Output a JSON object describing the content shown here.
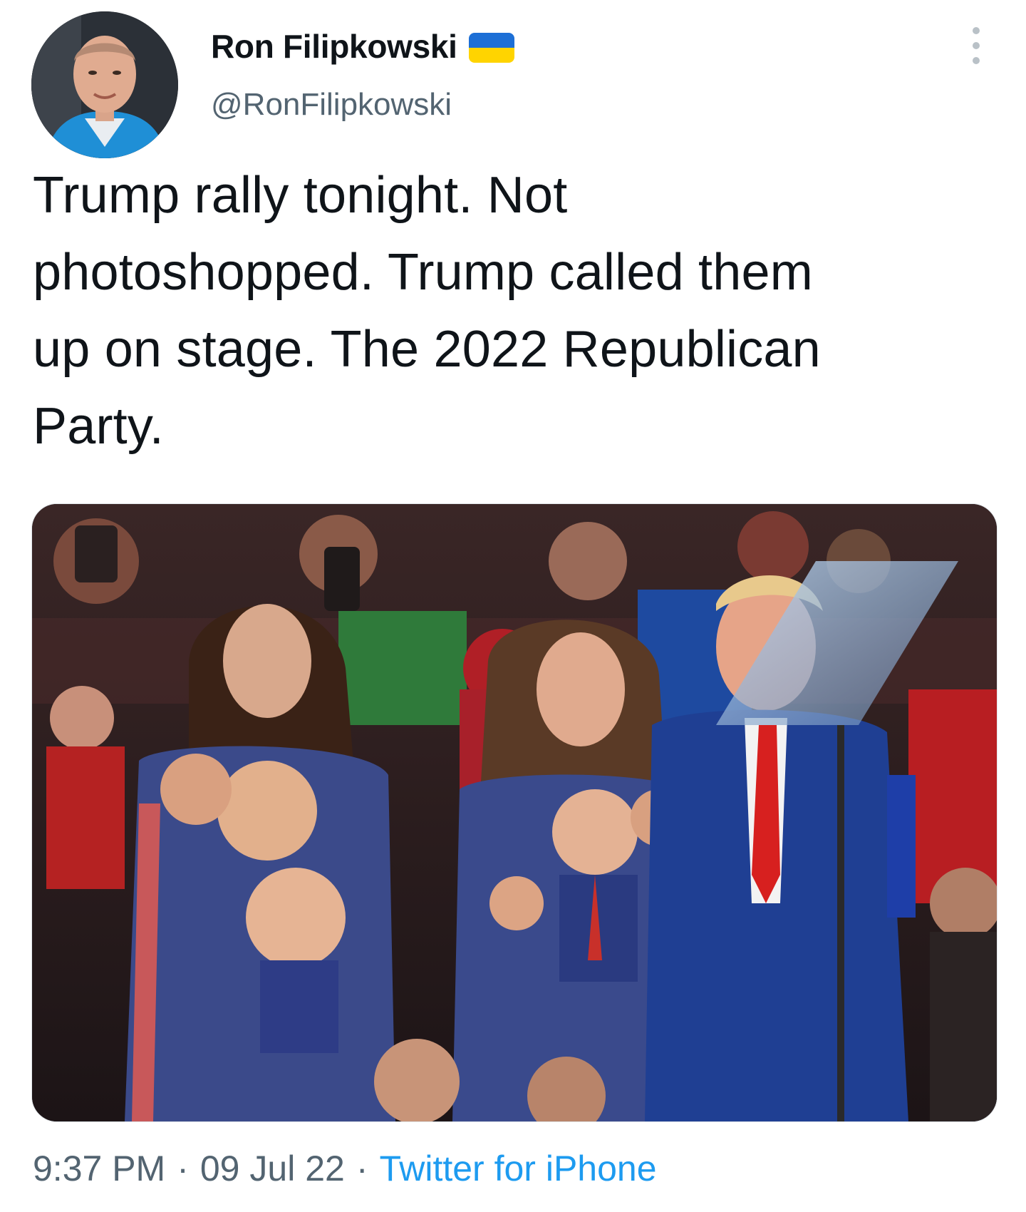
{
  "author": {
    "display_name": "Ron Filipkowski",
    "handle": "@RonFilipkowski",
    "flag_icon": "ukraine-flag-icon",
    "flag_colors": {
      "top": "#1d6fd6",
      "bottom": "#ffd400"
    }
  },
  "tweet": {
    "text": "Trump rally tonight. Not\nphotoshopped. Trump called them\nup on stage. The 2022 Republican\nParty.",
    "time": "9:37 PM",
    "separator": "·",
    "date": "09 Jul 22",
    "source": "Twitter for iPhone"
  },
  "media": {
    "type": "photo",
    "alt": ""
  },
  "colors": {
    "text": "#0f1419",
    "secondary": "#536471",
    "link": "#1d9bf0"
  }
}
